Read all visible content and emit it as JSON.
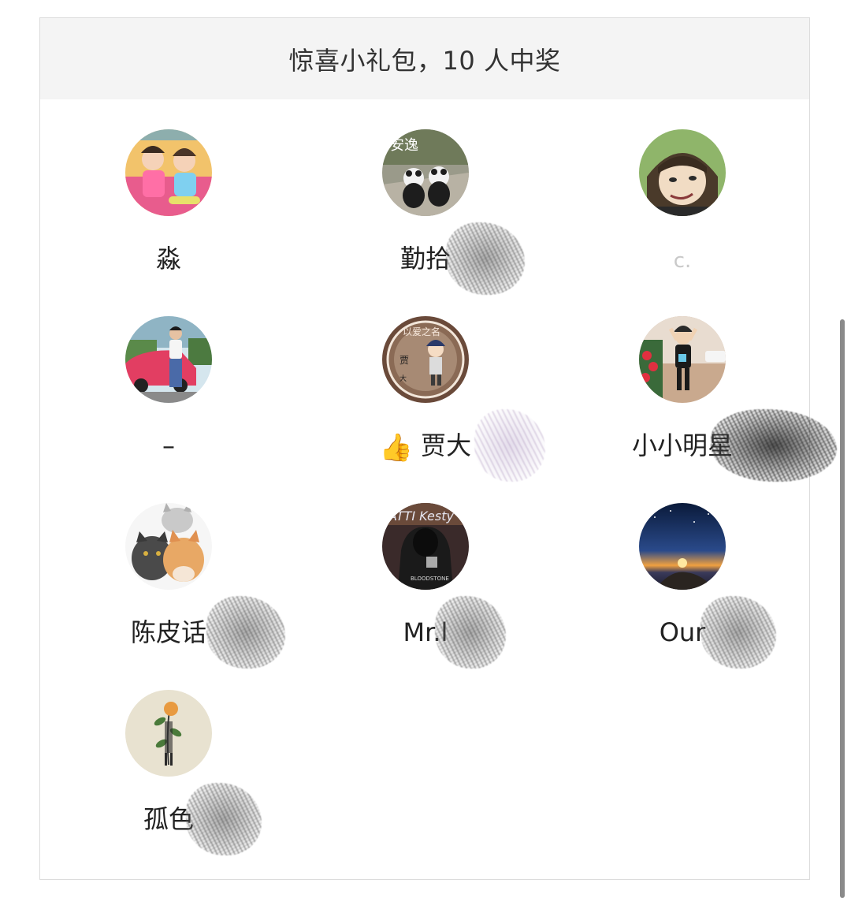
{
  "header": {
    "title": "惊喜小礼包，10 人中奖"
  },
  "winners": [
    {
      "name": "淼",
      "avatar": "kids-photo-avatar",
      "redacted": false
    },
    {
      "name": "勤拾",
      "avatar": "pandas-photo-avatar",
      "redacted": true
    },
    {
      "name": "c.",
      "avatar": "anime-character-avatar",
      "redacted": false
    },
    {
      "name": "–",
      "avatar": "man-with-car-avatar",
      "redacted": false
    },
    {
      "name": "贾大",
      "avatar": "cartoon-badge-avatar",
      "redacted": true,
      "prefix_icon": "👍"
    },
    {
      "name": "小小明星",
      "avatar": "child-photo-avatar",
      "redacted": true
    },
    {
      "name": "陈皮话",
      "avatar": "cats-photo-avatar",
      "redacted": true
    },
    {
      "name": "Mr.l",
      "avatar": "hooded-figure-avatar",
      "redacted": true
    },
    {
      "name": "Our",
      "avatar": "sunset-sky-avatar",
      "redacted": true
    },
    {
      "name": "孤色",
      "avatar": "flower-illustration-avatar",
      "redacted": true
    }
  ],
  "colors": {
    "header_bg": "#f4f4f4",
    "border": "#dcdcdc",
    "text": "#222222"
  }
}
